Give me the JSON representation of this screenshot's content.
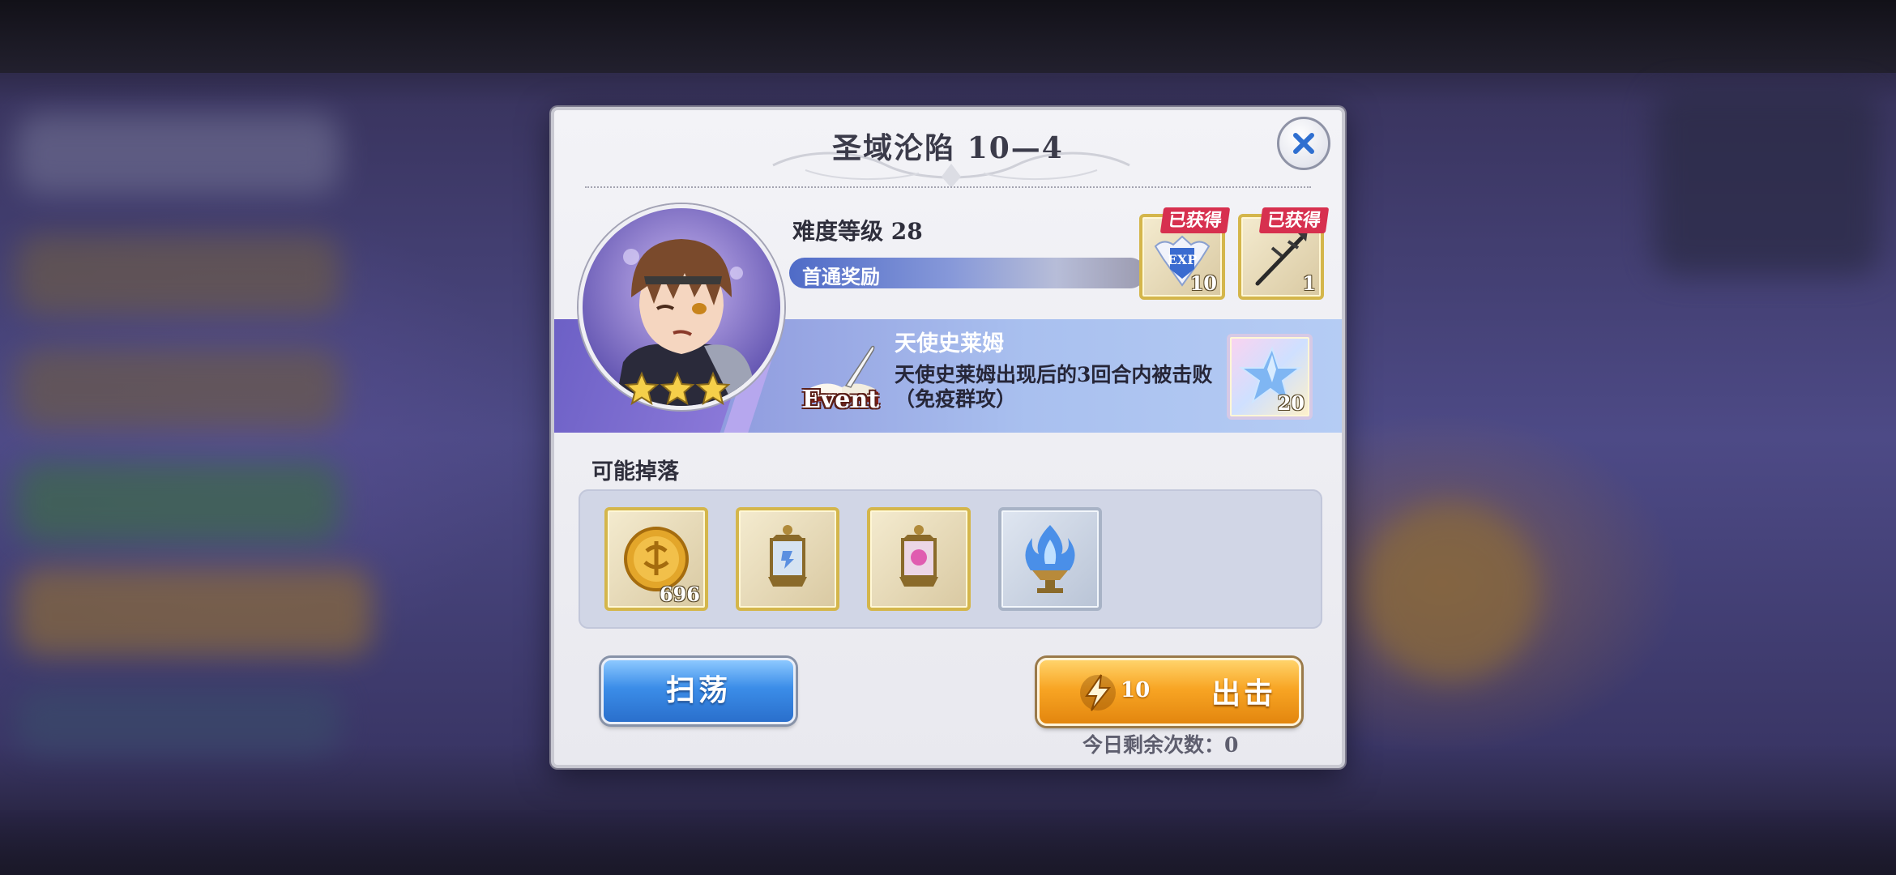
{
  "dialog": {
    "title": "圣域沦陷 10—4",
    "difficulty": "难度等级 28",
    "first_clear_label": "首通奖励",
    "first_clear_rewards": [
      {
        "icon": "exp-badge-icon",
        "count": "10",
        "tag": "已获得"
      },
      {
        "icon": "spear-icon",
        "count": "1",
        "tag": "已获得"
      }
    ],
    "event": {
      "badge": "Event",
      "name": "天使史莱姆",
      "description": "天使史莱姆出现后的3回合内被击败（免疫群攻）",
      "reward": {
        "icon": "crystal-star-icon",
        "count": "20"
      }
    },
    "drops_label": "可能掉落",
    "drops": [
      {
        "icon": "gold-coin-icon",
        "count": "696"
      },
      {
        "icon": "blue-lantern-icon",
        "count": ""
      },
      {
        "icon": "pink-lantern-icon",
        "count": ""
      },
      {
        "icon": "blue-flame-brazier-icon",
        "count": ""
      }
    ],
    "sweep_label": "扫荡",
    "attack_label": "出击",
    "attack_cost": "10",
    "remaining_text": "今日剩余次数：0",
    "stars": 3
  },
  "colors": {
    "accent_blue": "#3b8de8",
    "accent_orange": "#f8a524",
    "obtained_red": "#d7304f"
  }
}
